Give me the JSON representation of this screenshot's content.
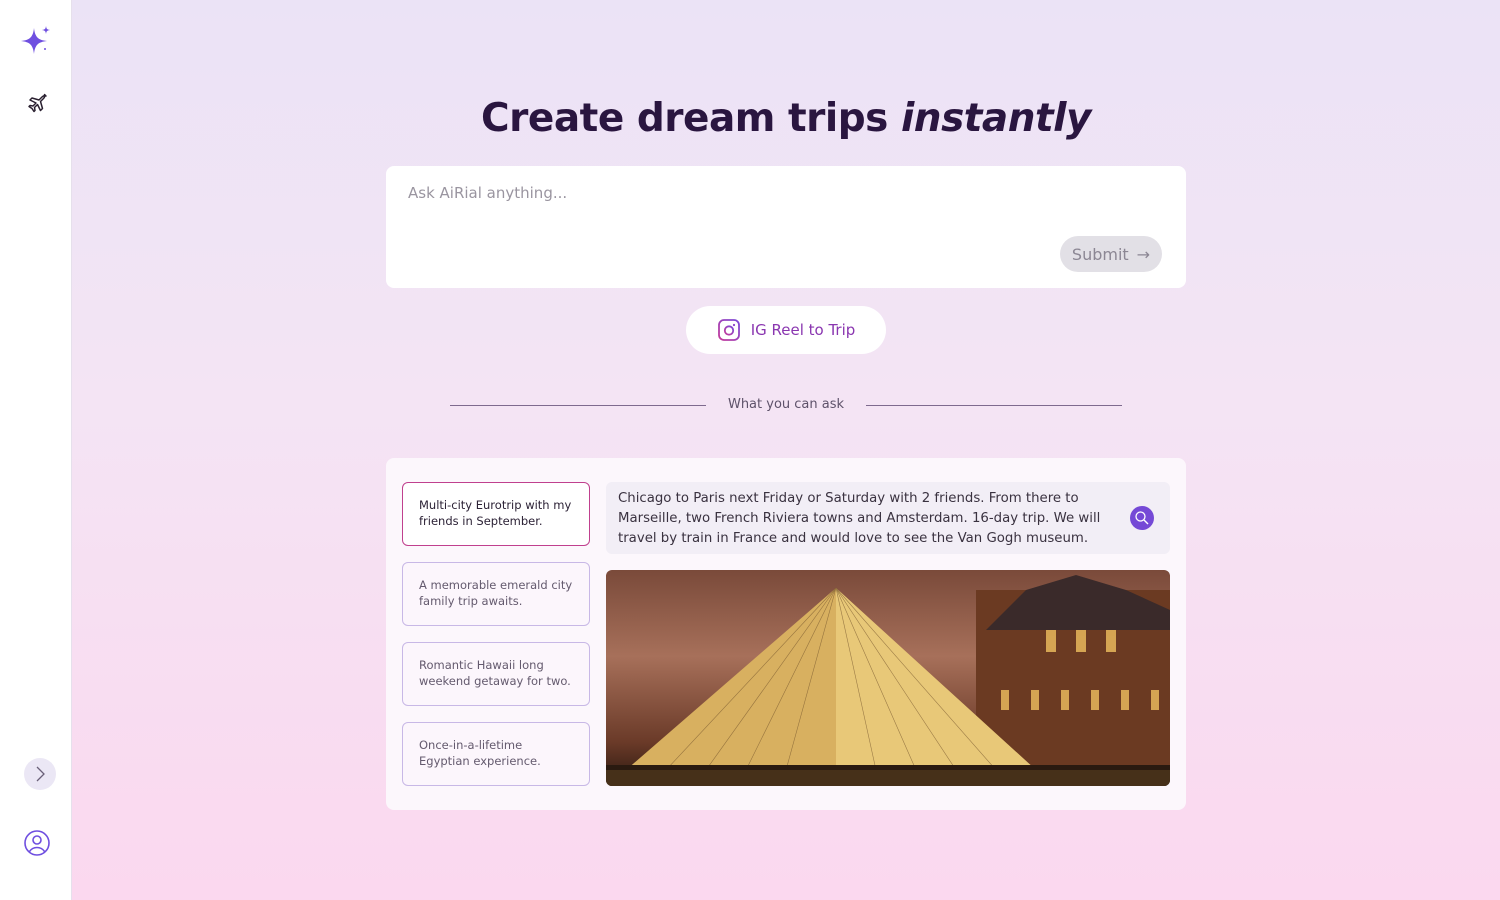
{
  "sidebar": {
    "logo": "sparkle-logo",
    "items": [
      {
        "icon": "airplane-icon"
      }
    ],
    "expand": "chevron-right-icon",
    "profile": "user-icon"
  },
  "header": {
    "title_main": "Create dream trips ",
    "title_em": "instantly"
  },
  "ask": {
    "placeholder": "Ask AiRial anything...",
    "value": "",
    "submit_label": "Submit"
  },
  "ig_button": {
    "label": "IG Reel to Trip"
  },
  "section": {
    "label": "What you can ask"
  },
  "examples": [
    {
      "label": "Multi-city Eurotrip with my friends in September.",
      "active": true
    },
    {
      "label": "A memorable emerald city family trip awaits.",
      "active": false
    },
    {
      "label": "Romantic Hawaii long weekend getaway for two.",
      "active": false
    },
    {
      "label": "Once-in-a-lifetime Egyptian experience.",
      "active": false
    }
  ],
  "example_detail": {
    "query": "Chicago to Paris next Friday or Saturday with 2 friends. From there to Marseille, two French Riviera towns and Amsterdam. 16-day trip. We will travel by train in France and would love to see the Van Gogh museum.",
    "image": "louvre-pyramid-night-photo"
  },
  "colors": {
    "accent": "#7549d6",
    "active_border": "#c0408e",
    "ig": "#8a36b0",
    "title": "#2a1640"
  }
}
